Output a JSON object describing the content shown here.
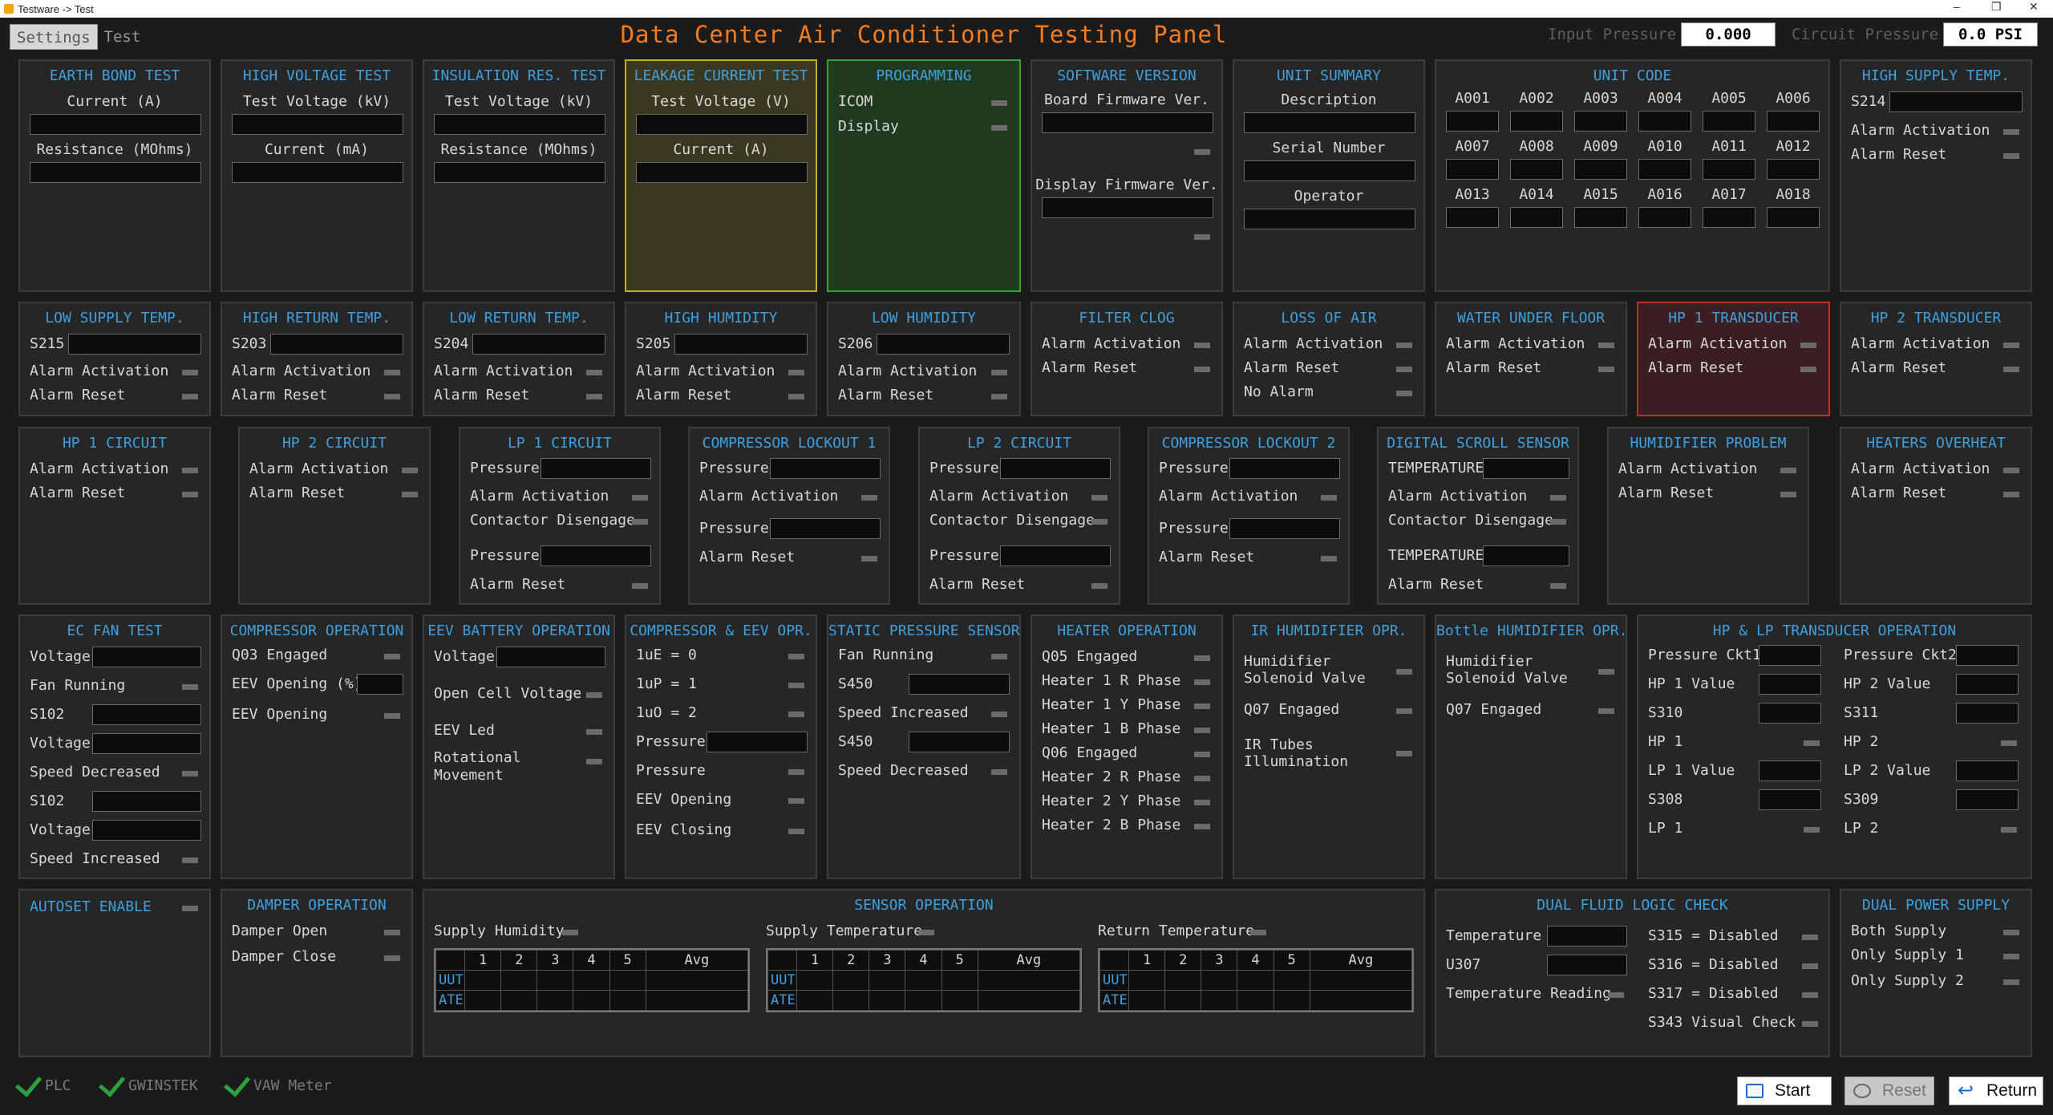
{
  "window": {
    "title": "Testware -> Test",
    "controls": [
      "–",
      "❐",
      "✕"
    ]
  },
  "tabs": [
    "Settings",
    "Test"
  ],
  "app_title": "Data Center Air Conditioner Testing Panel",
  "input_pressure": {
    "label": "Input Pressure",
    "value": "0.000"
  },
  "circuit_pressure": {
    "label": "Circuit Pressure",
    "value": "0.0 PSI"
  },
  "p": {
    "earth": {
      "title": "EARTH BOND TEST",
      "l1": "Current (A)",
      "l2": "Resistance (MOhms)"
    },
    "hv": {
      "title": "HIGH VOLTAGE TEST",
      "l1": "Test Voltage (kV)",
      "l2": "Current (mA)"
    },
    "ins": {
      "title": "INSULATION RES. TEST",
      "l1": "Test Voltage (kV)",
      "l2": "Resistance (MOhms)"
    },
    "leak": {
      "title": "LEAKAGE CURRENT TEST",
      "l1": "Test Voltage (V)",
      "l2": "Current (A)"
    },
    "prog": {
      "title": "PROGRAMMING",
      "l1": "ICOM",
      "l2": "Display"
    },
    "sw": {
      "title": "SOFTWARE VERSION",
      "l1": "Board Firmware Ver.",
      "l2": "Display Firmware Ver."
    },
    "unit": {
      "title": "UNIT SUMMARY",
      "l1": "Description",
      "l2": "Serial Number",
      "l3": "Operator"
    },
    "code": {
      "title": "UNIT CODE",
      "codes": [
        "A001",
        "A002",
        "A003",
        "A004",
        "A005",
        "A006",
        "A007",
        "A008",
        "A009",
        "A010",
        "A011",
        "A012",
        "A013",
        "A014",
        "A015",
        "A016",
        "A017",
        "A018"
      ]
    },
    "hst": {
      "title": "HIGH SUPPLY TEMP.",
      "s": "S214",
      "a": "Alarm Activation",
      "r": "Alarm Reset"
    },
    "lst": {
      "title": "LOW SUPPLY TEMP.",
      "s": "S215",
      "a": "Alarm Activation",
      "r": "Alarm Reset"
    },
    "hrt": {
      "title": "HIGH RETURN TEMP.",
      "s": "S203",
      "a": "Alarm Activation",
      "r": "Alarm Reset"
    },
    "lrt": {
      "title": "LOW RETURN TEMP.",
      "s": "S204",
      "a": "Alarm Activation",
      "r": "Alarm Reset"
    },
    "hh": {
      "title": "HIGH HUMIDITY",
      "s": "S205",
      "a": "Alarm Activation",
      "r": "Alarm Reset"
    },
    "lh": {
      "title": "LOW HUMIDITY",
      "s": "S206",
      "a": "Alarm Activation",
      "r": "Alarm Reset"
    },
    "fc": {
      "title": "FILTER CLOG",
      "a": "Alarm Activation",
      "r": "Alarm Reset"
    },
    "loa": {
      "title": "LOSS OF AIR",
      "a": "Alarm Activation",
      "r": "Alarm Reset",
      "n": "No Alarm"
    },
    "wuf": {
      "title": "WATER UNDER FLOOR",
      "a": "Alarm Activation",
      "r": "Alarm Reset"
    },
    "hp1t": {
      "title": "HP 1 TRANSDUCER",
      "a": "Alarm Activation",
      "r": "Alarm Reset"
    },
    "hp2t": {
      "title": "HP 2 TRANSDUCER",
      "a": "Alarm Activation",
      "r": "Alarm Reset"
    },
    "hp1c": {
      "title": "HP 1 CIRCUIT",
      "a": "Alarm Activation",
      "r": "Alarm Reset"
    },
    "hp2c": {
      "title": "HP 2 CIRCUIT",
      "a": "Alarm Activation",
      "r": "Alarm Reset"
    },
    "lp1c": {
      "title": "LP 1 CIRCUIT",
      "p1": "Pressure",
      "a": "Alarm Activation",
      "c": "Contactor Disengage",
      "p2": "Pressure",
      "r": "Alarm Reset"
    },
    "cl1": {
      "title": "COMPRESSOR LOCKOUT 1",
      "p1": "Pressure",
      "a": "Alarm Activation",
      "p2": "Pressure",
      "r": "Alarm Reset"
    },
    "lp2c": {
      "title": "LP 2 CIRCUIT",
      "p1": "Pressure",
      "a": "Alarm Activation",
      "c": "Contactor Disengage",
      "p2": "Pressure",
      "r": "Alarm Reset"
    },
    "cl2": {
      "title": "COMPRESSOR LOCKOUT 2",
      "p1": "Pressure",
      "a": "Alarm Activation",
      "p2": "Pressure",
      "r": "Alarm Reset"
    },
    "dss": {
      "title": "DIGITAL SCROLL SENSOR",
      "t1": "TEMPERATURE",
      "a": "Alarm Activation",
      "c": "Contactor Disengage",
      "t2": "TEMPERATURE",
      "r": "Alarm Reset"
    },
    "hum": {
      "title": "HUMIDIFIER PROBLEM",
      "a": "Alarm Activation",
      "r": "Alarm Reset"
    },
    "ho": {
      "title": "HEATERS OVERHEAT",
      "a": "Alarm Activation",
      "r": "Alarm Reset"
    },
    "ecf": {
      "title": "EC FAN TEST",
      "rows": [
        "Voltage",
        "Fan Running",
        "S102",
        "Voltage",
        "Speed Decreased",
        "S102",
        "Voltage",
        "Speed Increased"
      ]
    },
    "cop": {
      "title": "COMPRESSOR OPERATION",
      "r1": "Q03 Engaged",
      "r2": "EEV Opening (%)",
      "r3": "EEV Opening"
    },
    "eev": {
      "title": "EEV BATTERY OPERATION",
      "r1": "Voltage",
      "r2": "Open Cell Voltage",
      "r3": "EEV Led",
      "r4a": "Rotational",
      "r4b": "Movement"
    },
    "ceev": {
      "title": "COMPRESSOR & EEV OPR.",
      "rows": [
        "1uE = 0",
        "1uP = 1",
        "1uO = 2",
        "Pressure",
        "Pressure",
        "EEV Opening",
        "EEV Closing"
      ]
    },
    "sps": {
      "title": "STATIC PRESSURE SENSOR",
      "rows": [
        "Fan Running",
        "S450",
        "Speed Increased",
        "S450",
        "Speed Decreased"
      ]
    },
    "heat": {
      "title": "HEATER OPERATION",
      "rows": [
        "Q05 Engaged",
        "Heater 1 R Phase",
        "Heater 1 Y Phase",
        "Heater 1 B Phase",
        "Q06 Engaged",
        "Heater 2 R Phase",
        "Heater 2 Y Phase",
        "Heater 2 B Phase"
      ]
    },
    "irh": {
      "title": "IR HUMIDIFIER OPR.",
      "r1a": "Humidifier",
      "r1b": "Solenoid Valve",
      "r2": "Q07 Engaged",
      "r3a": "IR Tubes",
      "r3b": "Illumination"
    },
    "bh": {
      "title": "Bottle HUMIDIFIER OPR.",
      "r1a": "Humidifier",
      "r1b": "Solenoid Valve",
      "r2": "Q07 Engaged"
    },
    "hplp": {
      "title": "HP & LP TRANSDUCER OPERATION",
      "left": [
        "Pressure Ckt1",
        "HP 1 Value",
        "S310",
        "HP 1",
        "LP 1 Value",
        "S308",
        "LP 1"
      ],
      "right": [
        "Pressure Ckt2",
        "HP 2 Value",
        "S311",
        "HP 2",
        "LP 2 Value",
        "S309",
        "LP 2"
      ]
    },
    "auto": {
      "title": "AUTOSET ENABLE"
    },
    "damp": {
      "title": "DAMPER OPERATION",
      "r1": "Damper Open",
      "r2": "Damper Close"
    },
    "sens": {
      "title": "SENSOR OPERATION",
      "t1": "Supply Humidity",
      "t2": "Supply Temperature",
      "t3": "Return Temperature",
      "cols": [
        "1",
        "2",
        "3",
        "4",
        "5",
        "Avg"
      ],
      "rows": [
        "UUT",
        "ATE"
      ]
    },
    "dflc": {
      "title": "DUAL FLUID LOGIC CHECK",
      "l1": "Temperature",
      "l2": "U307",
      "l3": "Temperature Reading",
      "c1": "S315 = Disabled",
      "c2": "S316 = Disabled",
      "c3": "S317 = Disabled",
      "c4": "S343 Visual Check"
    },
    "dps": {
      "title": "DUAL POWER SUPPLY",
      "r1": "Both Supply",
      "r2": "Only Supply 1",
      "r3": "Only Supply 2"
    }
  },
  "status": {
    "plc": "PLC",
    "gw": "GWINSTEK",
    "vaw": "VAW Meter"
  },
  "buttons": {
    "start": "Start",
    "reset": "Reset",
    "ret": "Return"
  }
}
